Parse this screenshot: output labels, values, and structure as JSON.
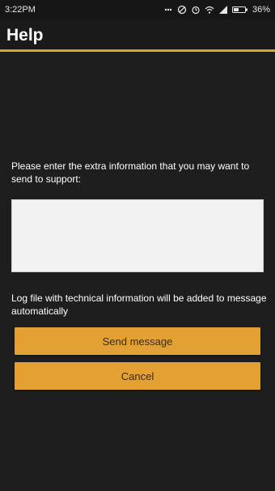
{
  "status_bar": {
    "time": "3:22PM",
    "battery": "36%",
    "icons": [
      "notification-dots-icon",
      "dnd-icon",
      "alarm-icon",
      "wifi-icon",
      "signal-icon",
      "battery-icon"
    ]
  },
  "app_bar": {
    "title": "Help",
    "accent_color": "#e3a033"
  },
  "form": {
    "prompt": "Please enter the extra information that you may want to send to support:",
    "extra_info_value": "",
    "log_note": "Log file with technical information will be added to message automatically"
  },
  "buttons": {
    "send_label": "Send message",
    "cancel_label": "Cancel"
  }
}
